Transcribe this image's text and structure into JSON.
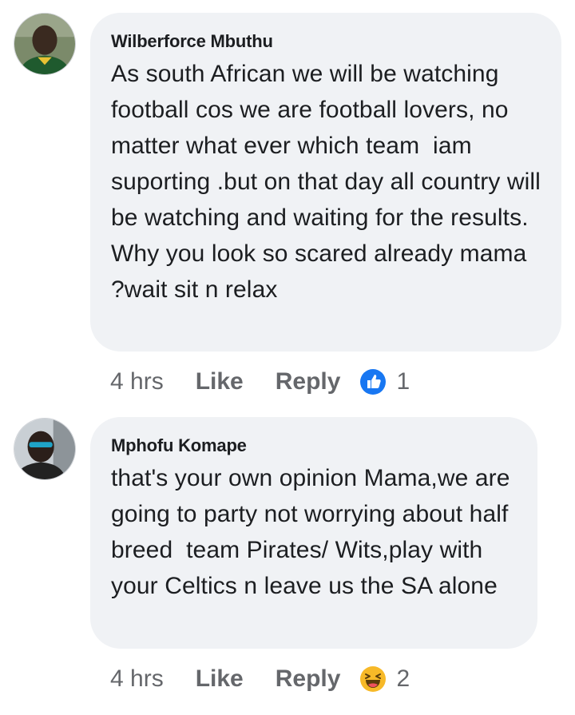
{
  "comments": [
    {
      "author": "Wilberforce Mbuthu",
      "text": "As south African we will be watching football cos we are football lovers, no matter what ever which team  iam suporting .but on that day all country will be watching and waiting for the results. Why you look so scared already mama ?wait sit n relax",
      "time": "4 hrs",
      "like_label": "Like",
      "reply_label": "Reply",
      "reaction_icon": "like-thumbs-up-icon",
      "reaction_count": "1",
      "reaction_color": "#1877f2"
    },
    {
      "author": "Mphofu Komape",
      "text": "that's your own opinion Mama,we are going to party not worrying about half breed  team Pirates/ Wits,play with your Celtics n leave us the SA alone",
      "time": "4 hrs",
      "like_label": "Like",
      "reply_label": "Reply",
      "reaction_icon": "haha-laughing-face-icon",
      "reaction_count": "2",
      "reaction_color": "#f7b928"
    }
  ]
}
